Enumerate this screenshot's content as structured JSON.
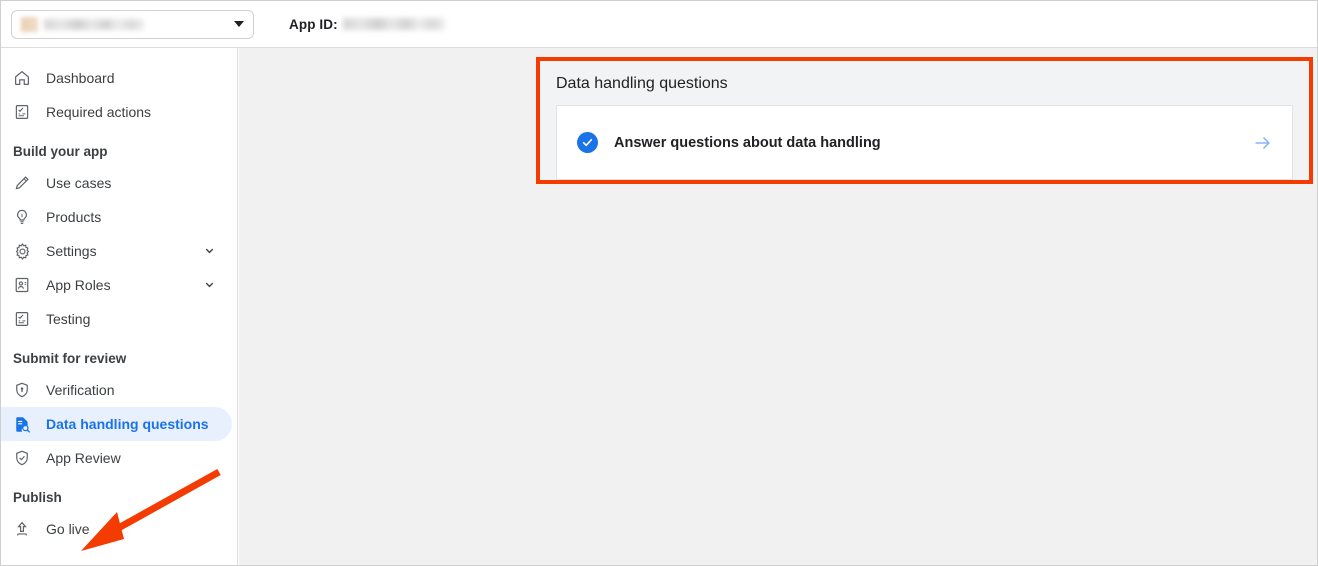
{
  "topbar": {
    "app_selector": {
      "name": "app-selector",
      "value": "",
      "redacted": true,
      "chevron_icon": "chevron-down-icon"
    },
    "app_id_label": "App ID:",
    "app_id_value": "",
    "app_id_redacted": true
  },
  "sidebar": {
    "items": [
      {
        "label": "Dashboard",
        "icon": "home-icon",
        "type": "item",
        "active": false,
        "expandable": false
      },
      {
        "label": "Required actions",
        "icon": "clipboard-check-icon",
        "type": "item",
        "active": false,
        "expandable": false
      },
      {
        "label": "Build your app",
        "icon": "",
        "type": "group",
        "active": false,
        "expandable": false
      },
      {
        "label": "Use cases",
        "icon": "pencil-icon",
        "type": "item",
        "active": false,
        "expandable": false
      },
      {
        "label": "Products",
        "icon": "lightbulb-icon",
        "type": "item",
        "active": false,
        "expandable": false
      },
      {
        "label": "Settings",
        "icon": "gear-icon",
        "type": "item",
        "active": false,
        "expandable": true
      },
      {
        "label": "App Roles",
        "icon": "badge-person-icon",
        "type": "item",
        "active": false,
        "expandable": true
      },
      {
        "label": "Testing",
        "icon": "clipboard-check-icon",
        "type": "item",
        "active": false,
        "expandable": false
      },
      {
        "label": "Submit for review",
        "icon": "",
        "type": "group",
        "active": false,
        "expandable": false
      },
      {
        "label": "Verification",
        "icon": "shield-lock-icon",
        "type": "item",
        "active": false,
        "expandable": false
      },
      {
        "label": "Data handling questions",
        "icon": "document-search-icon",
        "type": "item",
        "active": true,
        "expandable": false
      },
      {
        "label": "App Review",
        "icon": "shield-check-icon",
        "type": "item",
        "active": false,
        "expandable": false
      },
      {
        "label": "Publish",
        "icon": "",
        "type": "group",
        "active": false,
        "expandable": false
      },
      {
        "label": "Go live",
        "icon": "upload-icon",
        "type": "item",
        "active": false,
        "expandable": false
      }
    ]
  },
  "main": {
    "card": {
      "title": "Data handling questions",
      "task": {
        "label": "Answer questions about data handling",
        "status_icon": "check-circle-icon",
        "arrow_icon": "arrow-right-icon"
      }
    }
  },
  "annotations": {
    "card_highlight": {
      "name": "red-highlight-box",
      "color": "#f33b02"
    },
    "pointer_arrow": {
      "name": "red-pointer-arrow",
      "color": "#f33b02",
      "points_to": "Go live"
    }
  },
  "colors": {
    "accent_blue": "#1a73e8",
    "active_bg": "#e8f0fe",
    "annotation_red": "#f33b02",
    "main_bg": "#f1f1f1",
    "card_bg": "#f1f3f4"
  }
}
